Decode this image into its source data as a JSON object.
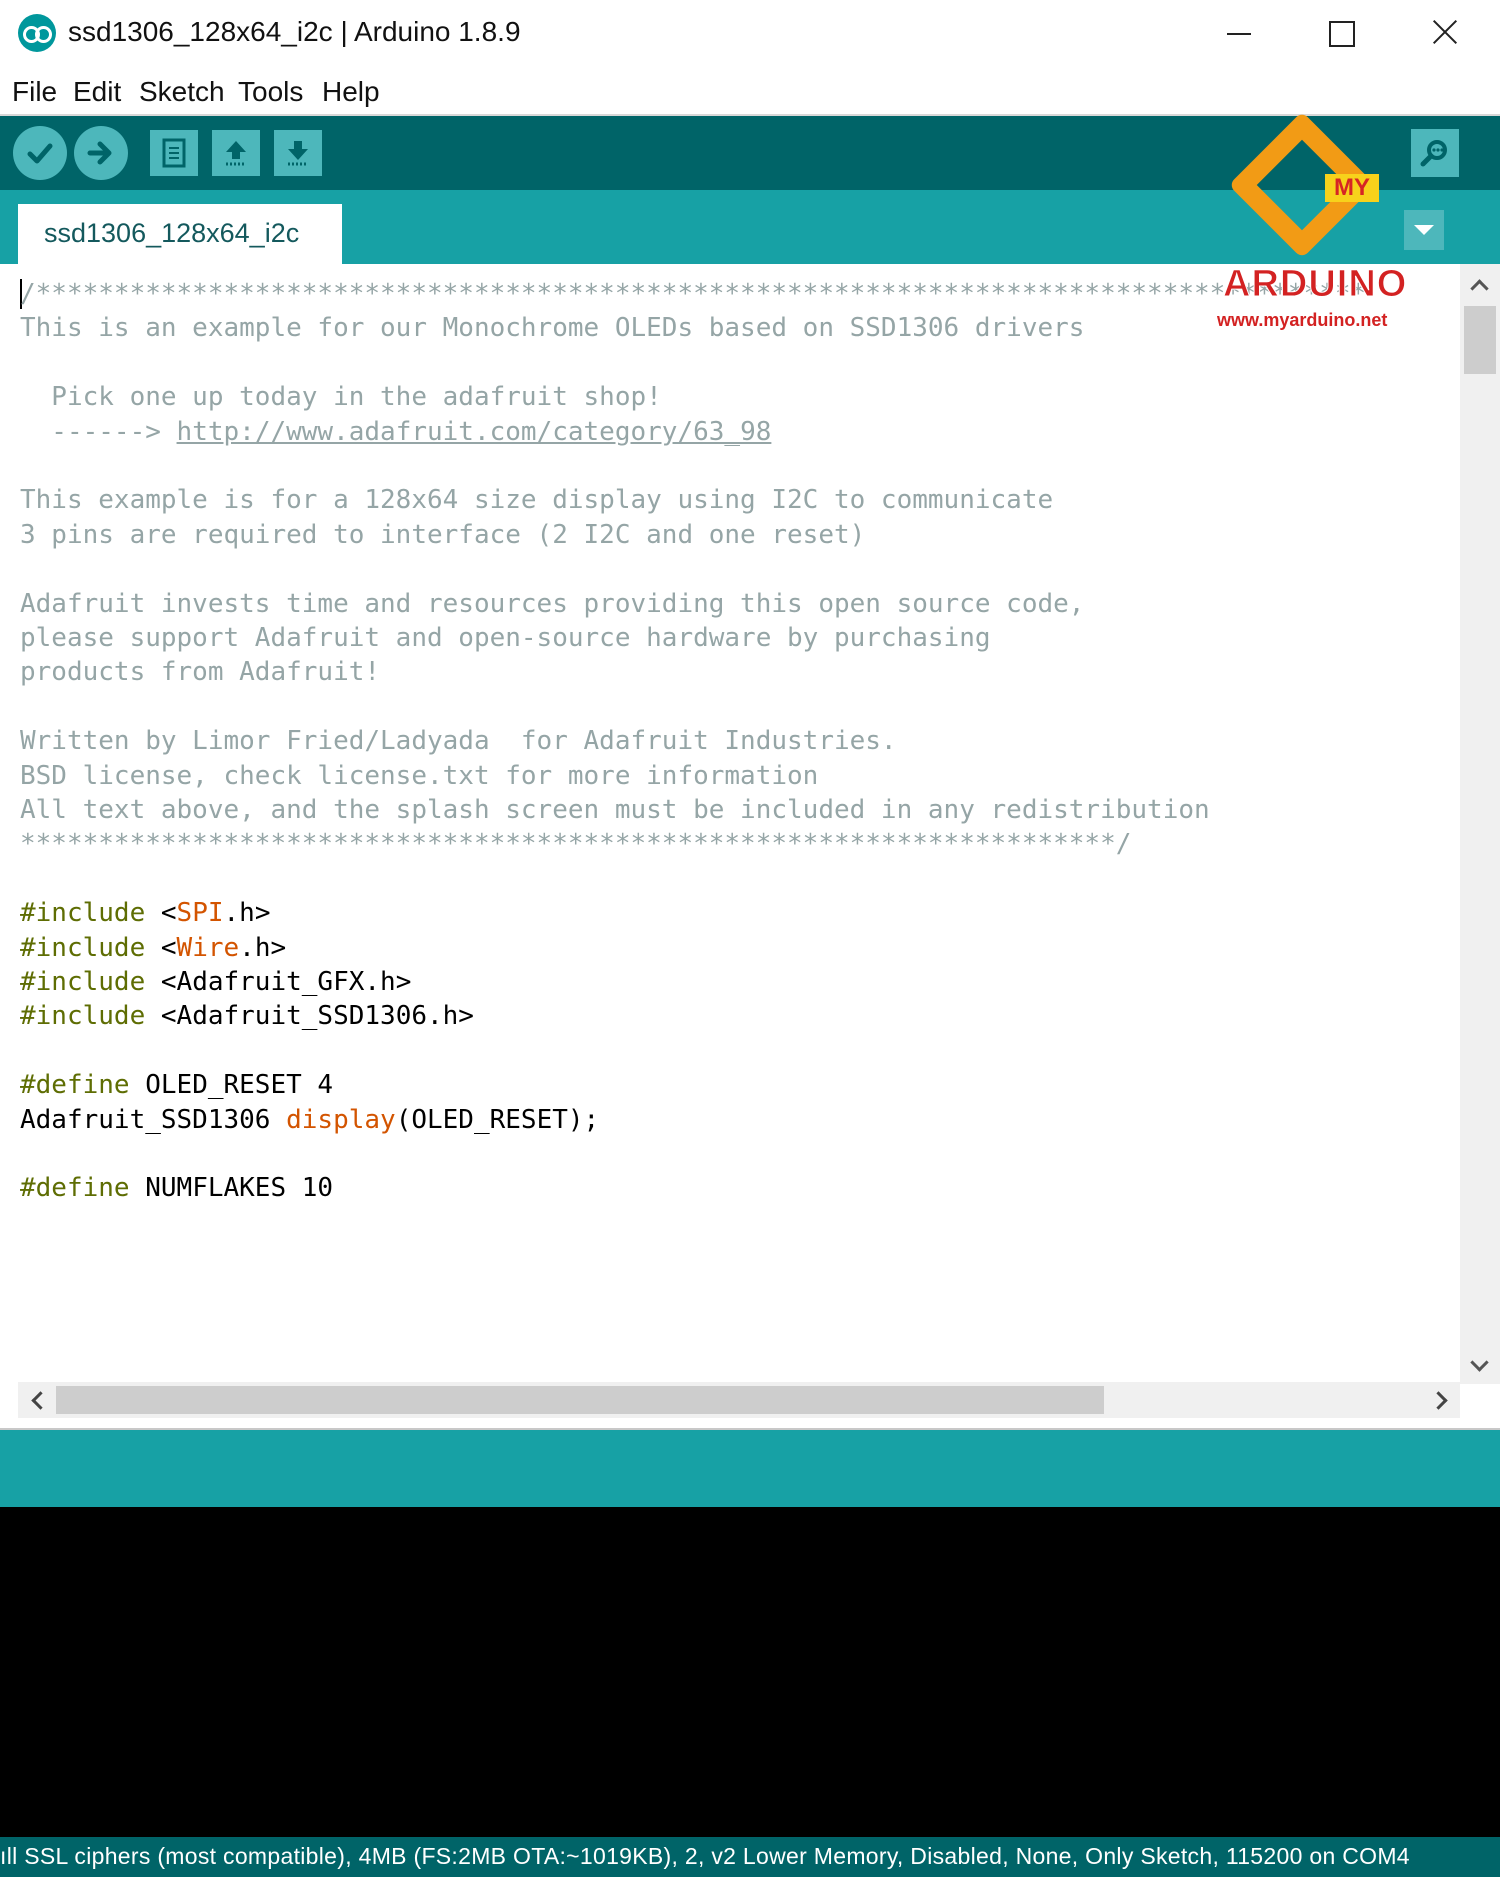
{
  "window": {
    "title": "ssd1306_128x64_i2c | Arduino 1.8.9",
    "icon": "arduino-logo-icon"
  },
  "menu": [
    "File",
    "Edit",
    "Sketch",
    "Tools",
    "Help"
  ],
  "toolbar": {
    "buttons": [
      "verify-icon",
      "upload-icon",
      "new-icon",
      "open-icon",
      "save-icon",
      "serial-monitor-icon"
    ]
  },
  "tabs": [
    {
      "label": "ssd1306_128x64_i2c",
      "active": true
    }
  ],
  "editor": {
    "lines": [
      {
        "segs": [
          {
            "t": "/*************************************************************************************",
            "c": "cm"
          }
        ]
      },
      {
        "segs": [
          {
            "t": "This is an example for our Monochrome OLEDs based on SSD1306 drivers",
            "c": "cm"
          }
        ]
      },
      {
        "segs": []
      },
      {
        "segs": [
          {
            "t": "  Pick one up today in the adafruit shop!",
            "c": "cm"
          }
        ]
      },
      {
        "segs": [
          {
            "t": "  ------> ",
            "c": "cm"
          },
          {
            "t": "http://www.adafruit.com/category/63_98",
            "c": "link"
          }
        ]
      },
      {
        "segs": []
      },
      {
        "segs": [
          {
            "t": "This example is for a 128x64 size display using I2C to communicate",
            "c": "cm"
          }
        ]
      },
      {
        "segs": [
          {
            "t": "3 pins are required to interface (2 I2C and one reset)",
            "c": "cm"
          }
        ]
      },
      {
        "segs": []
      },
      {
        "segs": [
          {
            "t": "Adafruit invests time and resources providing this open source code,",
            "c": "cm"
          }
        ]
      },
      {
        "segs": [
          {
            "t": "please support Adafruit and open-source hardware by purchasing",
            "c": "cm"
          }
        ]
      },
      {
        "segs": [
          {
            "t": "products from Adafruit!",
            "c": "cm"
          }
        ]
      },
      {
        "segs": []
      },
      {
        "segs": [
          {
            "t": "Written by Limor Fried/Ladyada  for Adafruit Industries.",
            "c": "cm"
          }
        ]
      },
      {
        "segs": [
          {
            "t": "BSD license, check license.txt for more information",
            "c": "cm"
          }
        ]
      },
      {
        "segs": [
          {
            "t": "All text above, and the splash screen must be included in any redistribution",
            "c": "cm"
          }
        ]
      },
      {
        "segs": [
          {
            "t": "**********************************************************************/",
            "c": "cm"
          }
        ]
      },
      {
        "segs": []
      },
      {
        "segs": [
          {
            "t": "#include",
            "c": "kw"
          },
          {
            "t": " <",
            "c": "cn"
          },
          {
            "t": "SPI",
            "c": "lib"
          },
          {
            "t": ".h>",
            "c": "cn"
          }
        ]
      },
      {
        "segs": [
          {
            "t": "#include",
            "c": "kw"
          },
          {
            "t": " <",
            "c": "cn"
          },
          {
            "t": "Wire",
            "c": "lib"
          },
          {
            "t": ".h>",
            "c": "cn"
          }
        ]
      },
      {
        "segs": [
          {
            "t": "#include",
            "c": "kw"
          },
          {
            "t": " <Adafruit_GFX.h>",
            "c": "cn"
          }
        ]
      },
      {
        "segs": [
          {
            "t": "#include",
            "c": "kw"
          },
          {
            "t": " <Adafruit_SSD1306.h>",
            "c": "cn"
          }
        ]
      },
      {
        "segs": []
      },
      {
        "segs": [
          {
            "t": "#define",
            "c": "kw"
          },
          {
            "t": " OLED_RESET 4",
            "c": "cn"
          }
        ]
      },
      {
        "segs": [
          {
            "t": "Adafruit_SSD1306 ",
            "c": "cn"
          },
          {
            "t": "display",
            "c": "lib"
          },
          {
            "t": "(OLED_RESET);",
            "c": "cn"
          }
        ]
      },
      {
        "segs": []
      },
      {
        "segs": [
          {
            "t": "#define",
            "c": "kw"
          },
          {
            "t": " NUMFLAKES 10",
            "c": "cn"
          }
        ]
      }
    ]
  },
  "status_bar": {
    "text": "ıll SSL ciphers (most compatible), 4MB (FS:2MB OTA:~1019KB), 2, v2 Lower Memory, Disabled, None, Only Sketch, 115200 on COM4"
  },
  "watermark": {
    "badge": "MY",
    "brand": "ARDUINO",
    "url": "www.myarduino.net"
  },
  "colors": {
    "toolbar": "#006468",
    "tabstrip": "#17a1a5",
    "button": "#4db7bb",
    "comment": "#95a5a6",
    "keyword": "#5e6d03",
    "library": "#d35400",
    "console": "#000000"
  }
}
